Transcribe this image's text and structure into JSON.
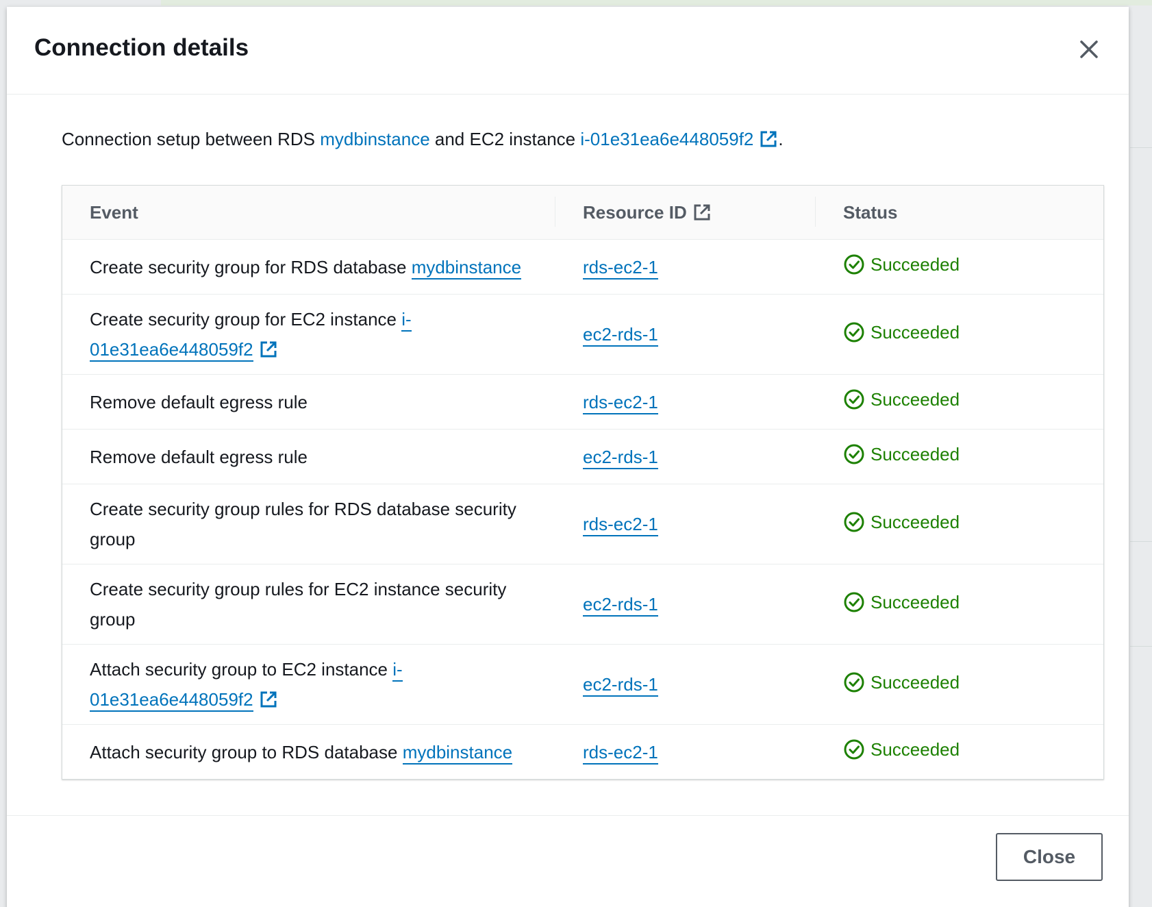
{
  "modal": {
    "title": "Connection details",
    "close_button": "Close"
  },
  "intro": {
    "prefix": "Connection setup between RDS ",
    "rds_link": "mydbinstance",
    "middle": " and EC2 instance ",
    "ec2_link": "i-01e31ea6e448059f2",
    "suffix": "."
  },
  "table": {
    "headers": {
      "event": "Event",
      "resource_id": "Resource ID",
      "status": "Status"
    },
    "rows": [
      {
        "event": "Create security group for RDS database ",
        "event_link": "mydbinstance",
        "resource": "rds-ec2-1",
        "status": "Succeeded"
      },
      {
        "event": "Create security group for EC2 instance ",
        "event_link": "i-01e31ea6e448059f2",
        "resource": "ec2-rds-1",
        "status": "Succeeded"
      },
      {
        "event": "Remove default egress rule",
        "event_link": "",
        "resource": "rds-ec2-1",
        "status": "Succeeded"
      },
      {
        "event": "Remove default egress rule",
        "event_link": "",
        "resource": "ec2-rds-1",
        "status": "Succeeded"
      },
      {
        "event": "Create security group rules for RDS database security group",
        "event_link": "",
        "resource": "rds-ec2-1",
        "status": "Succeeded"
      },
      {
        "event": "Create security group rules for EC2 instance security group",
        "event_link": "",
        "resource": "ec2-rds-1",
        "status": "Succeeded"
      },
      {
        "event": "Attach security group to EC2 instance ",
        "event_link": "i-01e31ea6e448059f2",
        "resource": "ec2-rds-1",
        "status": "Succeeded"
      },
      {
        "event": "Attach security group to RDS database ",
        "event_link": "mydbinstance",
        "resource": "rds-ec2-1",
        "status": "Succeeded"
      }
    ]
  },
  "colors": {
    "link": "#0073bb",
    "success": "#1d8102",
    "header_text": "#545b64"
  }
}
